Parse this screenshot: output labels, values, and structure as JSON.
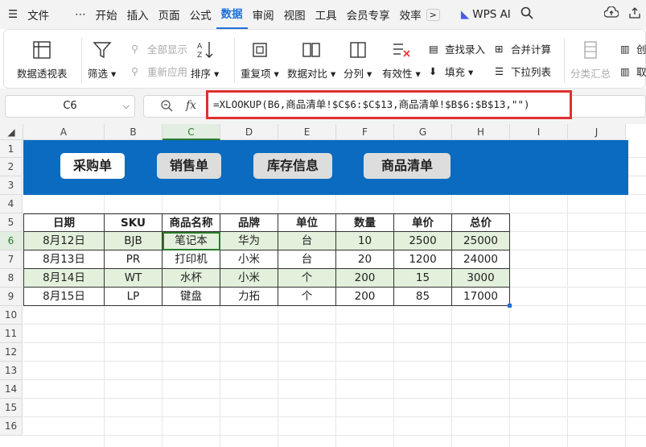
{
  "menubar": {
    "hamburger_icon": "menu-icon",
    "file": "文件",
    "more": "⋯",
    "tabs": [
      "开始",
      "插入",
      "页面",
      "公式",
      "数据",
      "审阅",
      "视图",
      "工具",
      "会员专享",
      "效率"
    ],
    "active_tab": "数据",
    "wps_ai": "WPS AI"
  },
  "ribbon": {
    "pivot": "数据透视表",
    "filter": "筛选",
    "show_all": "全部显示",
    "reapply": "重新应用",
    "sort": "排序",
    "duplicates": "重复项",
    "compare": "数据对比",
    "split_col": "分列",
    "validity": "有效性",
    "find_entry": "查找录入",
    "fill": "填充",
    "merge_calc": "合并计算",
    "dropdown_list": "下拉列表",
    "subtotal": "分类汇总",
    "create": "创",
    "take": "取"
  },
  "formula_bar": {
    "cell_ref": "C6",
    "fx": "fx",
    "formula": "=XLOOKUP(B6,商品清单!$C$6:$C$13,商品清单!$B$6:$B$13,\"\")"
  },
  "columns": [
    "A",
    "B",
    "C",
    "D",
    "E",
    "F",
    "G",
    "H",
    "I",
    "J"
  ],
  "selected_column": "C",
  "rows": [
    "1",
    "2",
    "3",
    "4",
    "5",
    "6",
    "7",
    "8",
    "9",
    "10",
    "11",
    "12",
    "13",
    "14",
    "15",
    "16"
  ],
  "selected_row": "6",
  "banner": {
    "buttons": [
      "采购单",
      "销售单",
      "库存信息",
      "商品清单"
    ],
    "active": "采购单"
  },
  "table": {
    "headers": [
      "日期",
      "SKU",
      "商品名称",
      "品牌",
      "单位",
      "数量",
      "单价",
      "总价"
    ],
    "rows": [
      [
        "8月12日",
        "BJB",
        "笔记本",
        "华为",
        "台",
        "10",
        "2500",
        "25000"
      ],
      [
        "8月13日",
        "PR",
        "打印机",
        "小米",
        "台",
        "20",
        "1200",
        "24000"
      ],
      [
        "8月14日",
        "WT",
        "水杯",
        "小米",
        "个",
        "200",
        "15",
        "3000"
      ],
      [
        "8月15日",
        "LP",
        "键盘",
        "力拓",
        "个",
        "200",
        "85",
        "17000"
      ]
    ]
  },
  "colors": {
    "accent": "#1e6fd9",
    "banner": "#0a6bc0",
    "highlight": "#e03030",
    "row_fill": "#e3f0dc",
    "selected": "#2d7a2d"
  }
}
